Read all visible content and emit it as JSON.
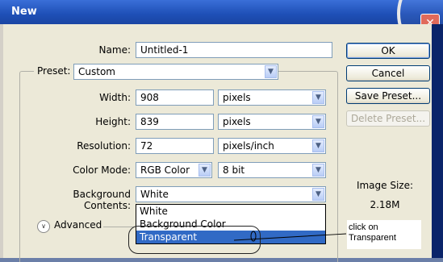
{
  "window": {
    "title": "New",
    "close_glyph": "✕"
  },
  "form": {
    "name_label": "Name:",
    "name_value": "Untitled-1",
    "preset_label": "Preset:",
    "preset_value": "Custom",
    "width_label": "Width:",
    "width_value": "908",
    "width_unit": "pixels",
    "height_label": "Height:",
    "height_value": "839",
    "height_unit": "pixels",
    "resolution_label": "Resolution:",
    "resolution_value": "72",
    "resolution_unit": "pixels/inch",
    "color_mode_label": "Color Mode:",
    "color_mode_value": "RGB Color",
    "bit_depth_value": "8 bit",
    "background_label": "Background Contents:",
    "background_value": "White",
    "advanced_label": "Advanced"
  },
  "background_options": [
    {
      "label": "White",
      "selected": false
    },
    {
      "label": "Background Color",
      "selected": false
    },
    {
      "label": "Transparent",
      "selected": true
    }
  ],
  "buttons": {
    "ok": "OK",
    "cancel": "Cancel",
    "save_preset": "Save Preset...",
    "delete_preset": "Delete Preset..."
  },
  "image_size": {
    "label": "Image Size:",
    "value": "2.18M"
  },
  "annotation": {
    "line1": "click on",
    "line2": "Transparent"
  },
  "icons": {
    "dropdown": "chevron-down-icon",
    "advanced": "double-chevron-icon",
    "close": "close-icon"
  },
  "colors": {
    "titlebar": "#1e4fb6",
    "selection": "#316ac5",
    "dialog_bg": "#ece9d8"
  }
}
